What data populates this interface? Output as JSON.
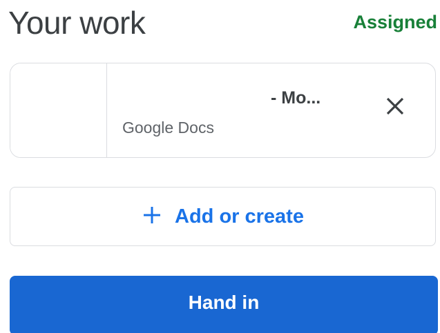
{
  "header": {
    "title": "Your work",
    "status": "Assigned"
  },
  "attachment": {
    "name": "- Mo...",
    "type": "Google Docs",
    "remove_icon": "close-icon"
  },
  "add_button": {
    "icon": "plus-icon",
    "label": "Add or create"
  },
  "hand_in_button": {
    "label": "Hand in"
  },
  "colors": {
    "status_green": "#188038",
    "accent_blue": "#1a73e8",
    "primary_button": "#1967d2"
  }
}
